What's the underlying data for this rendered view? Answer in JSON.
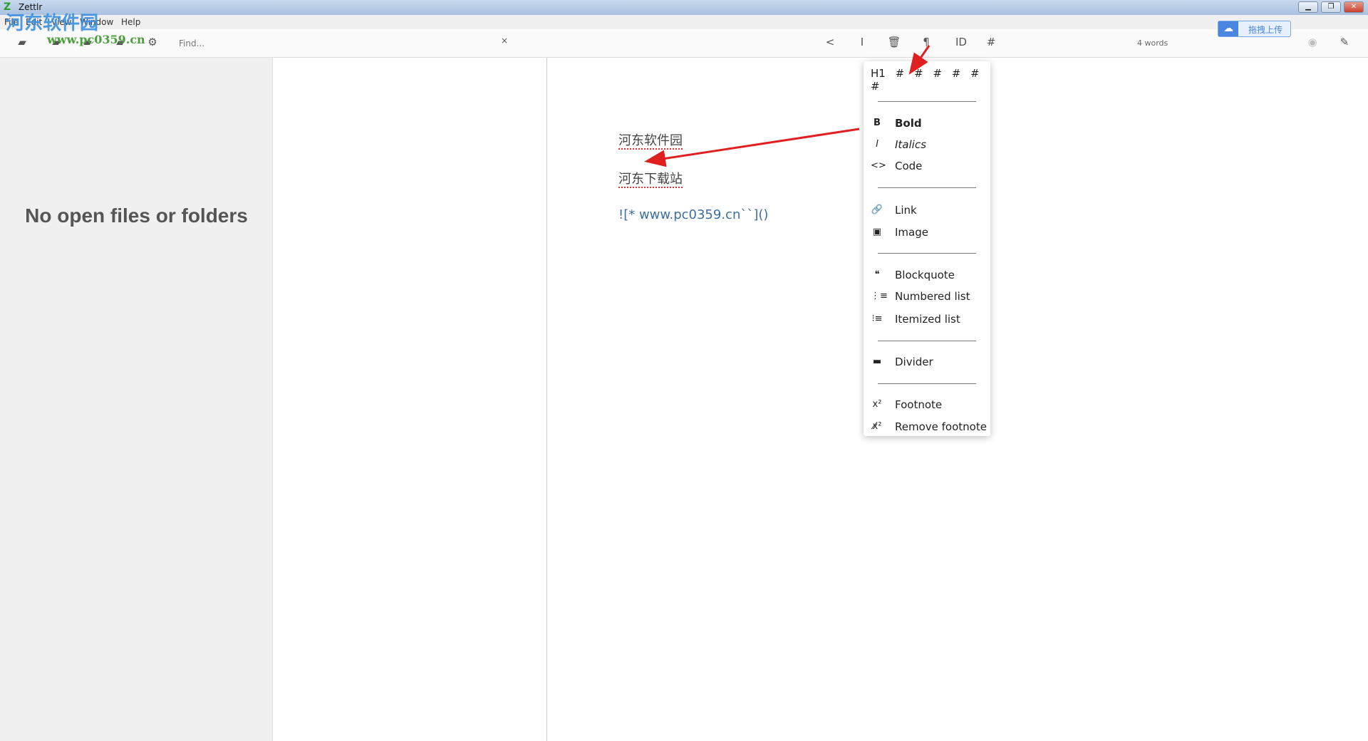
{
  "window": {
    "title": "Zettlr"
  },
  "menubar": [
    "File",
    "Edit",
    "View",
    "Window",
    "Help"
  ],
  "toolbar": {
    "find_placeholder": "Find...",
    "clear": "×",
    "word_count": "4 words"
  },
  "overlay": {
    "baidu_upload": "拖拽上传",
    "watermark": "河东软件园",
    "watermark_url": "www.pc0359.cn"
  },
  "sidebar": {
    "empty_message": "No open files or folders"
  },
  "editor": {
    "lines": [
      "河东软件园",
      "河东下载站",
      "![* www.pc0359.cn``]()"
    ]
  },
  "context_menu": {
    "headings": [
      "H1",
      "#",
      "#",
      "#",
      "#",
      "#",
      "#"
    ],
    "items": [
      {
        "label": "Bold",
        "icon": "bold-icon",
        "glyph": "B"
      },
      {
        "label": "Italics",
        "icon": "italic-icon",
        "glyph": "I"
      },
      {
        "label": "Code",
        "icon": "code-icon",
        "glyph": "<>"
      },
      {
        "label": "Link",
        "icon": "link-icon",
        "glyph": "🔗"
      },
      {
        "label": "Image",
        "icon": "image-icon",
        "glyph": "▣"
      },
      {
        "label": "Blockquote",
        "icon": "quote-icon",
        "glyph": "❝"
      },
      {
        "label": "Numbered list",
        "icon": "numbered-list-icon",
        "glyph": "⋮≡"
      },
      {
        "label": "Itemized list",
        "icon": "itemized-list-icon",
        "glyph": "⁝≡"
      },
      {
        "label": "Divider",
        "icon": "divider-icon",
        "glyph": "▬"
      },
      {
        "label": "Footnote",
        "icon": "footnote-icon",
        "glyph": "x²"
      },
      {
        "label": "Remove footnote",
        "icon": "remove-footnote-icon",
        "glyph": "x̸²"
      }
    ]
  },
  "colors": {
    "annotation_arrow": "#e02020",
    "accent": "#4a86e0"
  }
}
